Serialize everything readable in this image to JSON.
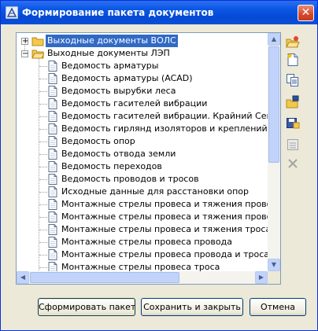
{
  "window": {
    "title": "Формирование пакета документов"
  },
  "tree": {
    "roots": [
      {
        "label": "Выходные документы ВОЛС",
        "expander": "+"
      },
      {
        "label": "Выходные документы ЛЭП",
        "expander": "−"
      }
    ],
    "children": [
      "Ведомость арматуры",
      "Ведомость арматуры (ACAD)",
      "Ведомость вырубки леса",
      "Ведомость гасителей вибрации",
      "Ведомость гасителей вибрации. Крайний Север",
      "Ведомость гирлянд изоляторов и креплений троса",
      "Ведомость опор",
      "Ведомость отвода земли",
      "Ведомость переходов",
      "Ведомость проводов и тросов",
      "Исходные данные для расстановки опор",
      "Монтажные стрелы провеса и тяжения провода и т",
      "Монтажные стрелы провеса и тяжения провода и т",
      "Монтажные стрелы провеса и тяжения троса",
      "Монтажные стрелы провеса провода",
      "Монтажные стрелы провеса провода и троса (Вари",
      "Монтажные стрелы провеса троса"
    ]
  },
  "side_toolbar": [
    {
      "icon": "open-folder-icon"
    },
    {
      "icon": "new-document-icon"
    },
    {
      "icon": "copy-icon"
    },
    {
      "icon": "folder-lock-icon"
    },
    {
      "icon": "save-lock-icon"
    },
    {
      "icon": "properties-icon"
    },
    {
      "icon": "delete-icon"
    }
  ],
  "buttons": {
    "form": "Сформировать пакет",
    "save_close": "Сохранить и закрыть",
    "cancel": "Отмена"
  },
  "colors": {
    "titlebar": "#0a58e5",
    "selection": "#316ac5",
    "folder": "#f2c94c"
  }
}
